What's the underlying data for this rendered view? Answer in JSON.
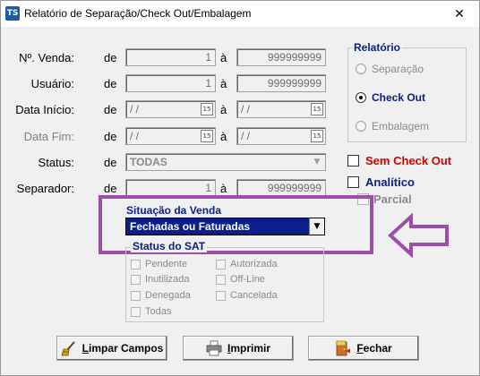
{
  "window": {
    "title": "Relatório de Separação/Check Out/Embalagem",
    "icon_text": "TS",
    "close_glyph": "✕"
  },
  "form": {
    "de": "de",
    "ate": "à",
    "rows": [
      {
        "label": "Nº. Venda:",
        "from": "1",
        "to": "999999999"
      },
      {
        "label": "Usuário:",
        "from": "1",
        "to": "999999999"
      },
      {
        "label": "Data Início:",
        "from": "/ /",
        "to": "/ /"
      },
      {
        "label": "Data Fim:",
        "from": "/ /",
        "to": "/ /"
      },
      {
        "label": "Status:",
        "value": "TODAS"
      },
      {
        "label": "Separador:",
        "from": "1",
        "to": "999999999"
      }
    ],
    "date_btn": "15",
    "combo_arrow": "▼"
  },
  "relatorio": {
    "title": "Relatório",
    "options": [
      "Separação",
      "Check Out",
      "Embalagem"
    ],
    "selected": "Check Out"
  },
  "checks": {
    "sem_check_out": "Sem Check Out",
    "analitico": "Analítico",
    "parcial": "Parcial"
  },
  "situacao": {
    "label": "Situação da Venda",
    "value": "Fechadas ou Faturadas",
    "arrow": "▼"
  },
  "status_sat": {
    "title": "Status do SAT",
    "col1": [
      "Pendente",
      "Inutilizada",
      "Denegada",
      "Todas"
    ],
    "col2": [
      "Autorizada",
      "Off-Line",
      "Cancelada"
    ]
  },
  "buttons": {
    "limpar": "Limpar Campos",
    "imprimir": "Imprimir",
    "fechar": "Fechar"
  },
  "colors": {
    "highlight": "#9b4fa8",
    "accent": "#0a1e8c",
    "red": "#d40000"
  }
}
